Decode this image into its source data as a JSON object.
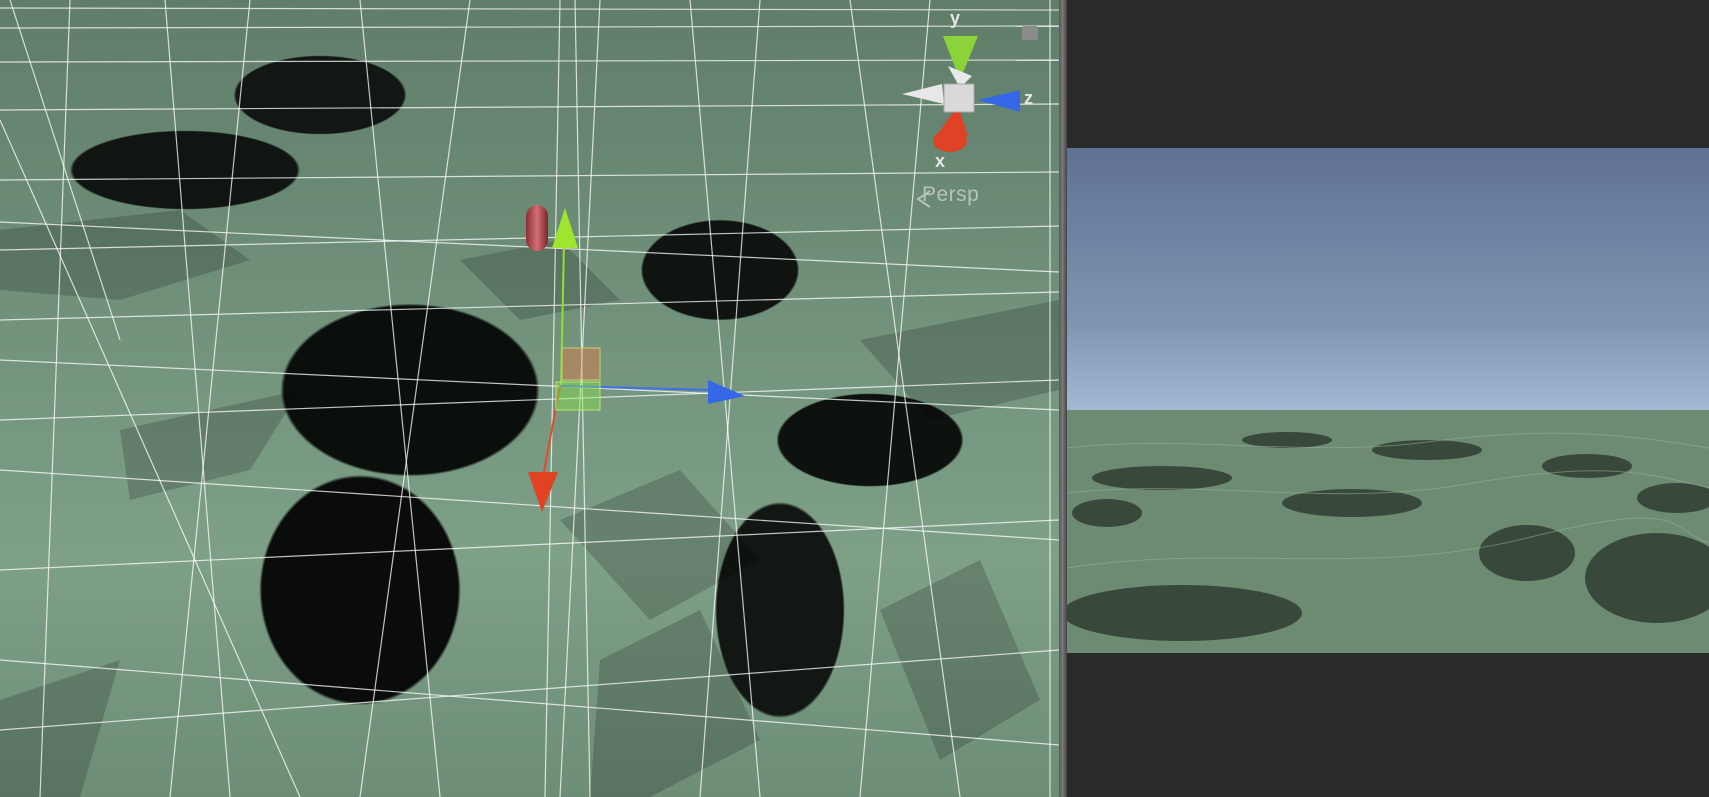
{
  "scene_view": {
    "projection_label": "Persp",
    "axis_labels": {
      "y": "y",
      "z": "z",
      "x": "x"
    },
    "colors": {
      "terrain": "#6f8f79",
      "grid": "#ffffff",
      "axis_y": "#9be032",
      "axis_z": "#3f6ff0",
      "axis_x": "#e1452a"
    }
  },
  "game_view": {
    "colors": {
      "sky_top": "#5f7193",
      "horizon": "#f4f7f0",
      "terrain": "#6b8a72",
      "background": "#2a2a2a"
    }
  }
}
